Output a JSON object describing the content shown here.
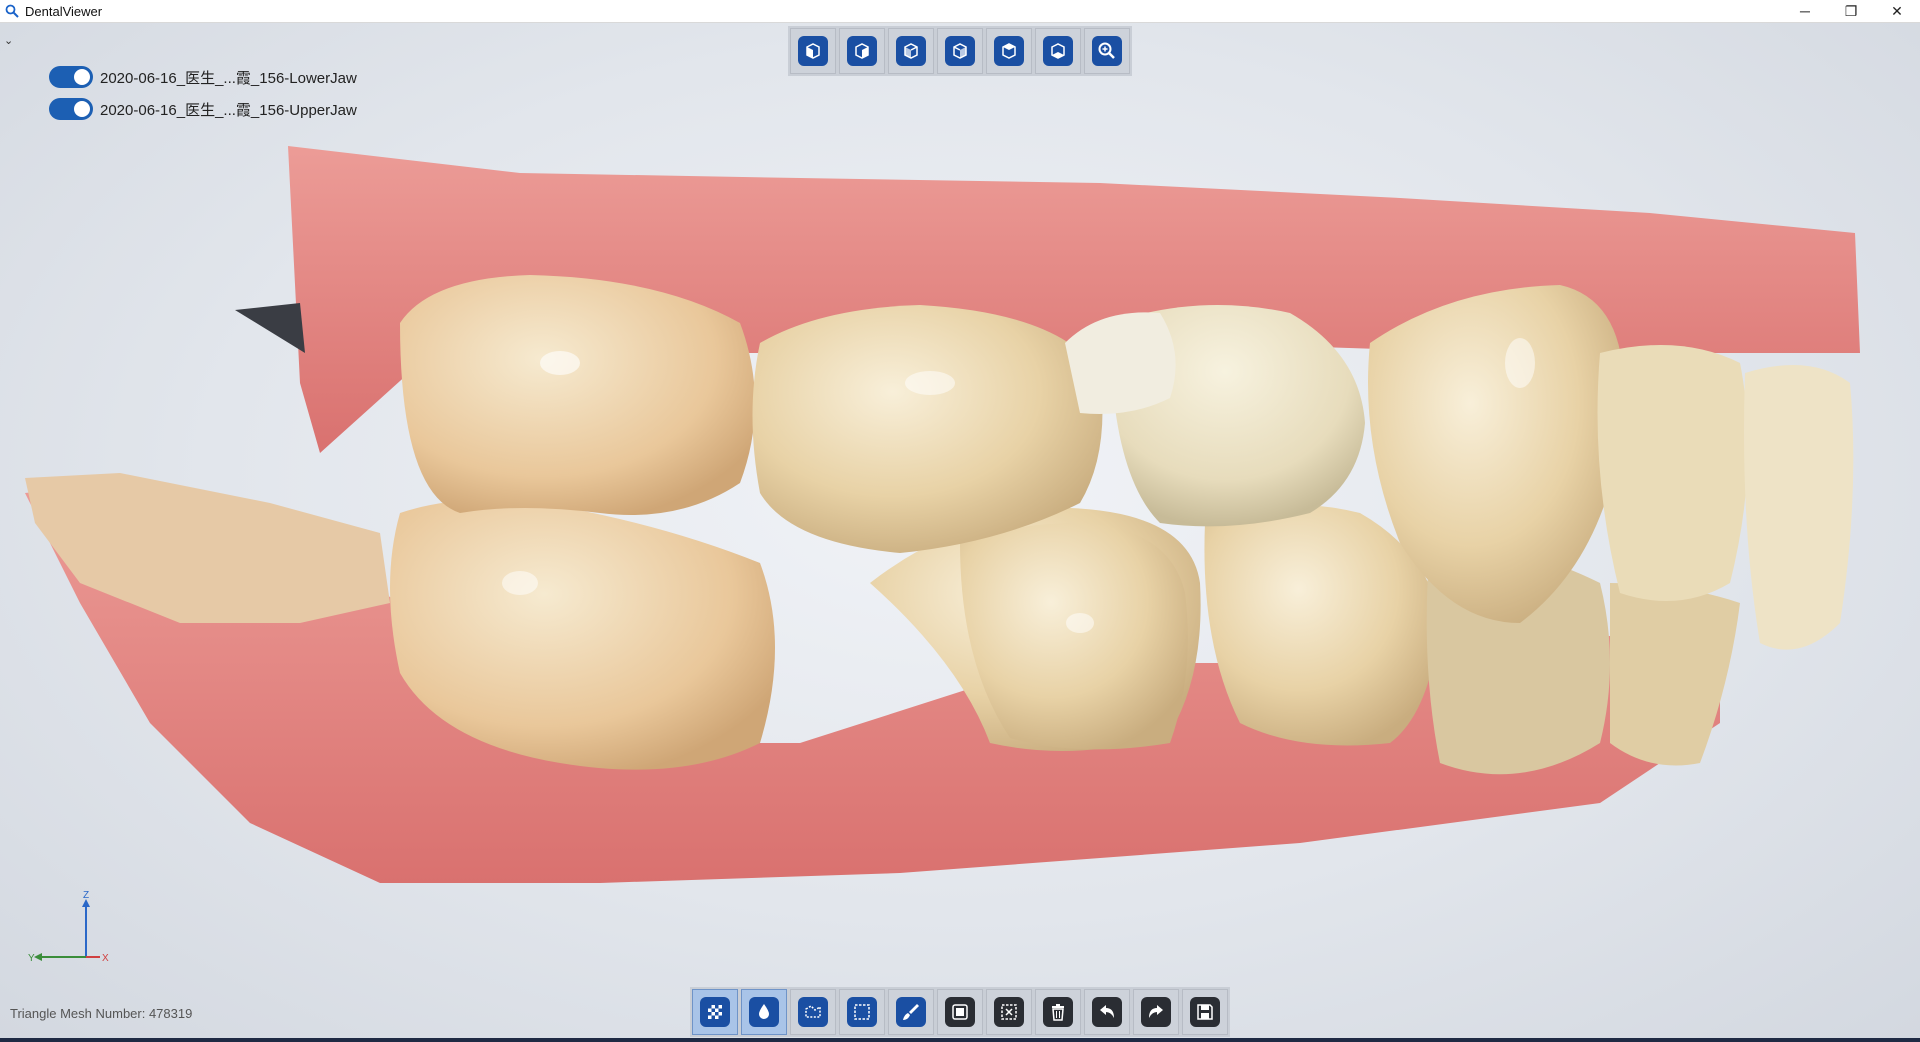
{
  "window": {
    "title": "DentalViewer",
    "controls": {
      "minimize": "─",
      "restore": "❐",
      "close": "✕"
    }
  },
  "layers": [
    {
      "label": "2020-06-16_医生_...霞_156-LowerJaw",
      "visible": true
    },
    {
      "label": "2020-06-16_医生_...霞_156-UpperJaw",
      "visible": true
    }
  ],
  "view_toolbar": [
    {
      "name": "front-view-icon"
    },
    {
      "name": "back-view-icon"
    },
    {
      "name": "left-view-icon"
    },
    {
      "name": "right-view-icon"
    },
    {
      "name": "top-view-icon"
    },
    {
      "name": "bottom-view-icon"
    },
    {
      "name": "zoom-icon"
    }
  ],
  "edit_toolbar": [
    {
      "name": "texture-icon",
      "active": true
    },
    {
      "name": "color-drop-icon",
      "active": true
    },
    {
      "name": "lasso-select-icon",
      "active": false
    },
    {
      "name": "rect-select-icon",
      "active": false
    },
    {
      "name": "brush-icon",
      "active": false
    },
    {
      "name": "select-all-icon",
      "active": false
    },
    {
      "name": "deselect-icon",
      "active": false
    },
    {
      "name": "delete-icon",
      "active": false
    },
    {
      "name": "undo-icon",
      "active": false
    },
    {
      "name": "redo-icon",
      "active": false
    },
    {
      "name": "save-icon",
      "active": false
    }
  ],
  "status": {
    "triangle_mesh": "Triangle Mesh Number: 478319"
  },
  "axis": {
    "z": "Z",
    "y": "Y",
    "x": "X"
  },
  "colors": {
    "accent": "#1c5fb3",
    "icon_blue": "#1a4fa3",
    "gum": "#e48f8a",
    "tooth": "#eedcb8"
  }
}
